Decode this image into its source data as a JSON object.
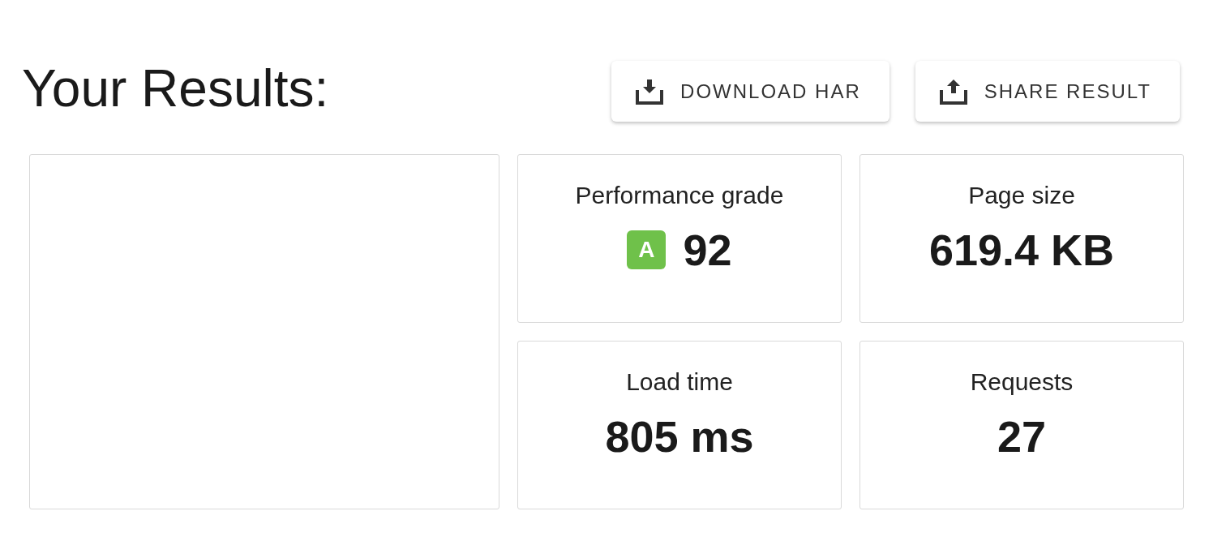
{
  "page": {
    "title": "Your Results:"
  },
  "actions": [
    {
      "label": "DOWNLOAD HAR",
      "kind": "download"
    },
    {
      "label": "SHARE RESULT",
      "kind": "share"
    }
  ],
  "metrics": [
    {
      "label": "Performance grade",
      "value": "92",
      "grade": "A"
    },
    {
      "label": "Page size",
      "value": "619.4 KB"
    },
    {
      "label": "Load time",
      "value": "805 ms"
    },
    {
      "label": "Requests",
      "value": "27"
    }
  ]
}
